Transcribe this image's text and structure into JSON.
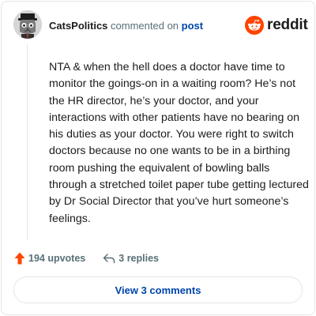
{
  "comment": {
    "username": "CatsPolitics",
    "action_text": "commented on",
    "target_text": "post",
    "body": "NTA & when the hell does a doctor have time to monitor the goings-on in a waiting room? He’s not the HR director, he’s your doctor, and your interactions with other patients have no bearing on his duties as your doctor. You were right to switch doctors because no one wants to be in a birthing room pushing the equivalent of bowling balls through a stretched toilet paper tube getting lectured by Dr Social Director that you’ve hurt someone’s feelings.",
    "upvotes_label": "194 upvotes",
    "replies_label": "3 replies"
  },
  "brand": {
    "wordmark": "reddit",
    "icon": "reddit-snoo-icon",
    "color": "#ff4500"
  },
  "footer": {
    "view_comments_label": "View 3 comments"
  },
  "icons": {
    "avatar": "cat-avatar-icon",
    "upvote": "upvote-arrow-icon",
    "reply": "reply-arrow-icon"
  },
  "colors": {
    "link": "#0045ac",
    "muted": "#576f76",
    "upvote": "#ff4500",
    "border": "#e6e6e6"
  }
}
